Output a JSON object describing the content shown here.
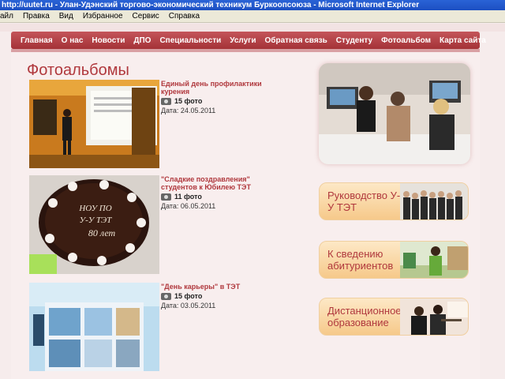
{
  "window": {
    "title": "http://uutet.ru - Улан-Удэнский торгово-экономический техникум Буркоопсоюза - Microsoft Internet Explorer"
  },
  "menubar": [
    "айл",
    "Правка",
    "Вид",
    "Избранное",
    "Сервис",
    "Справка"
  ],
  "nav": [
    "Главная",
    "О нас",
    "Новости",
    "ДПО",
    "Специальности",
    "Услуги",
    "Обратная связь",
    "Студенту",
    "Фотоальбом",
    "Карта сайта"
  ],
  "page_title": "Фотоальбомы",
  "albums": [
    {
      "title": "Единый день профилактики курения",
      "count": "15 фото",
      "date": "Дата: 24.05.2011"
    },
    {
      "title": "\"Сладкие поздравления\" студентов к Юбилею ТЭТ",
      "count": "11 фото",
      "date": "Дата: 06.05.2011",
      "cake_text_1": "НОУ ПО",
      "cake_text_2": "У-У ТЭТ",
      "cake_text_3": "80 лет"
    },
    {
      "title": "\"День карьеры\" в ТЭТ",
      "count": "15 фото",
      "date": "Дата: 03.05.2011"
    }
  ],
  "banners": [
    {
      "text": "Руководство У-У ТЭТ"
    },
    {
      "text": "К сведению абитуриентов"
    },
    {
      "text": "Дистанционное образование"
    }
  ],
  "colors": {
    "accent": "#b0383d",
    "nav": "#b4444a",
    "banner": "#f6c98a"
  }
}
